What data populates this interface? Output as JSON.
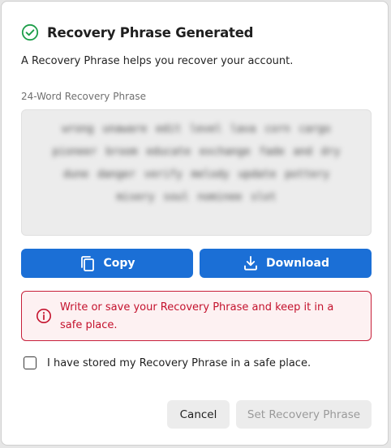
{
  "dialog": {
    "title": "Recovery Phrase Generated",
    "title_icon": "check-circle-icon",
    "subtitle": "A Recovery Phrase helps you recover your account.",
    "phrase_label": "24-Word Recovery Phrase",
    "phrase_text": "wrong unaware edit level lava corn cargo pioneer broom educate exchange fade and dry dune danger verify melody update pottery misery soul nominee slot"
  },
  "actions": {
    "copy_label": "Copy",
    "copy_icon": "copy-icon",
    "download_label": "Download",
    "download_icon": "download-icon"
  },
  "warning": {
    "icon": "info-circle-icon",
    "text": "Write or save your Recovery Phrase and keep it in a safe place."
  },
  "confirmation": {
    "label": "I have stored my Recovery Phrase in a safe place.",
    "checked": false
  },
  "footer": {
    "cancel_label": "Cancel",
    "set_label": "Set Recovery Phrase",
    "set_disabled": true
  },
  "colors": {
    "primary": "#1b6fd6",
    "success": "#1e9e4a",
    "danger": "#c4122d",
    "danger_bg": "#fdf1f2"
  }
}
